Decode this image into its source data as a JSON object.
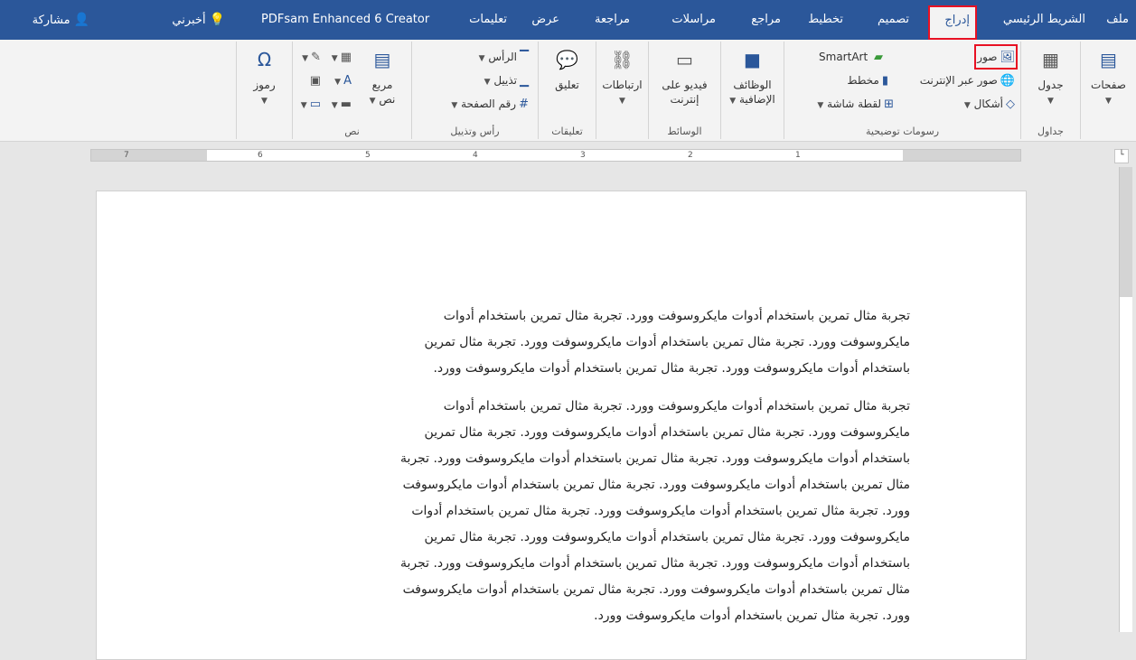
{
  "tabs": {
    "file": "ملف",
    "home": "الشريط الرئيسي",
    "insert": "إدراج",
    "design": "تصميم",
    "layout": "تخطيط",
    "references": "مراجع",
    "mailings": "مراسلات",
    "review": "مراجعة",
    "view": "عرض",
    "help": "تعليمات",
    "pdfsam": "PDFsam Enhanced 6 Creator",
    "tellme": "أخبرني",
    "share": "مشاركة"
  },
  "ribbon": {
    "pages": {
      "label": "صفحات",
      "group": ""
    },
    "tables": {
      "table": "جدول",
      "group": "جداول"
    },
    "illustrations": {
      "pictures": "صور",
      "online_pictures": "صور عبر الإنترنت",
      "shapes": "أشكال",
      "smartart": "SmartArt",
      "chart": "مخطط",
      "screenshot": "لقطة شاشة",
      "group": "رسومات توضيحية"
    },
    "addins": {
      "label_l1": "الوظائف",
      "label_l2": "الإضافية",
      "group": ""
    },
    "media": {
      "label_l1": "فيديو على",
      "label_l2": "إنترنت",
      "group": "الوسائط"
    },
    "links": {
      "label": "ارتباطات"
    },
    "comments": {
      "label": "تعليق",
      "group": "تعليقات"
    },
    "header_footer": {
      "header": "الرأس",
      "footer": "تذييل",
      "page_number": "رقم الصفحة",
      "group": "رأس وتذييل"
    },
    "text": {
      "textbox_l1": "مربع",
      "textbox_l2": "نص",
      "group": "نص"
    },
    "symbols": {
      "label": "رموز"
    }
  },
  "ruler": {
    "numbers": [
      "7",
      "6",
      "5",
      "4",
      "3",
      "2",
      "1"
    ]
  },
  "document": {
    "para1": [
      "تجربة مثال تمرين باستخدام أدوات مايكروسوفت وورد. تجربة مثال تمرين باستخدام أدوات",
      "مايكروسوفت وورد. تجربة مثال تمرين باستخدام أدوات مايكروسوفت وورد. تجربة مثال تمرين",
      "باستخدام أدوات مايكروسوفت وورد. تجربة مثال تمرين باستخدام أدوات مايكروسوفت وورد."
    ],
    "para2": [
      "تجربة مثال تمرين باستخدام أدوات مايكروسوفت وورد. تجربة مثال تمرين باستخدام أدوات",
      "مايكروسوفت وورد. تجربة مثال تمرين باستخدام أدوات مايكروسوفت وورد. تجربة مثال تمرين",
      "باستخدام أدوات مايكروسوفت وورد. تجربة مثال تمرين باستخدام أدوات مايكروسوفت وورد. تجربة",
      "مثال تمرين باستخدام أدوات مايكروسوفت وورد. تجربة مثال تمرين باستخدام أدوات مايكروسوفت",
      "وورد. تجربة مثال تمرين باستخدام أدوات مايكروسوفت وورد. تجربة مثال تمرين باستخدام أدوات",
      "مايكروسوفت وورد. تجربة مثال تمرين باستخدام أدوات مايكروسوفت وورد. تجربة مثال تمرين",
      "باستخدام أدوات مايكروسوفت وورد. تجربة مثال تمرين باستخدام أدوات مايكروسوفت وورد. تجربة",
      "مثال تمرين باستخدام أدوات مايكروسوفت وورد. تجربة مثال تمرين باستخدام أدوات مايكروسوفت",
      "وورد. تجربة مثال تمرين باستخدام أدوات مايكروسوفت وورد."
    ]
  },
  "colors": {
    "accent": "#2b579a",
    "highlight": "#e81123"
  }
}
